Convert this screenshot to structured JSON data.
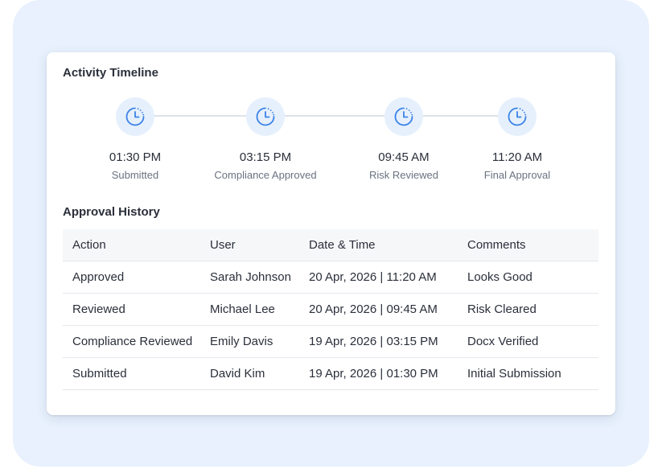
{
  "colors": {
    "accent": "#3b82e6",
    "icon_bg": "#e6f0fd",
    "frame_bg": "#e8f1fd"
  },
  "timeline": {
    "title": "Activity Timeline",
    "steps": [
      {
        "time": "01:30 PM",
        "label": "Submitted",
        "icon": "clock-icon"
      },
      {
        "time": "03:15 PM",
        "label": "Compliance Approved",
        "icon": "clock-icon"
      },
      {
        "time": "09:45 AM",
        "label": "Risk Reviewed",
        "icon": "clock-icon"
      },
      {
        "time": "11:20 AM",
        "label": "Final Approval",
        "icon": "clock-icon"
      }
    ]
  },
  "history": {
    "title": "Approval History",
    "columns": [
      "Action",
      "User",
      "Date & Time",
      "Comments"
    ],
    "rows": [
      [
        "Approved",
        "Sarah Johnson",
        "20 Apr, 2026 | 11:20 AM",
        "Looks Good"
      ],
      [
        "Reviewed",
        "Michael Lee",
        "20 Apr, 2026 | 09:45 AM",
        "Risk Cleared"
      ],
      [
        "Compliance Reviewed",
        "Emily Davis",
        "19 Apr, 2026 | 03:15 PM",
        "Docx Verified"
      ],
      [
        "Submitted",
        "David Kim",
        "19 Apr, 2026 | 01:30 PM",
        "Initial Submission"
      ]
    ]
  }
}
